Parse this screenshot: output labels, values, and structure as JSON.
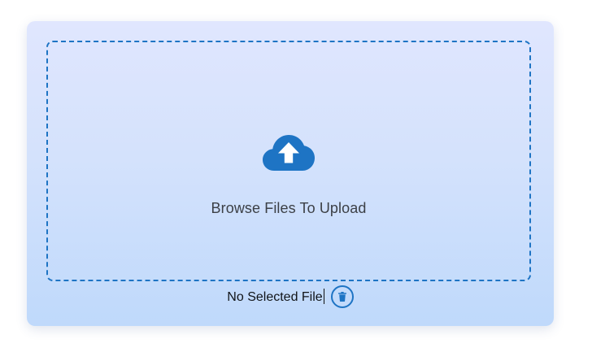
{
  "upload": {
    "prompt": "Browse Files To Upload",
    "icon": "cloud-upload-icon"
  },
  "file": {
    "status_text": "No Selected File",
    "delete_icon": "trash-icon"
  },
  "colors": {
    "accent": "#1e74c4",
    "card_top": "#e0e6fe",
    "card_bottom": "#bfd9fb",
    "text": "#3c4046"
  }
}
